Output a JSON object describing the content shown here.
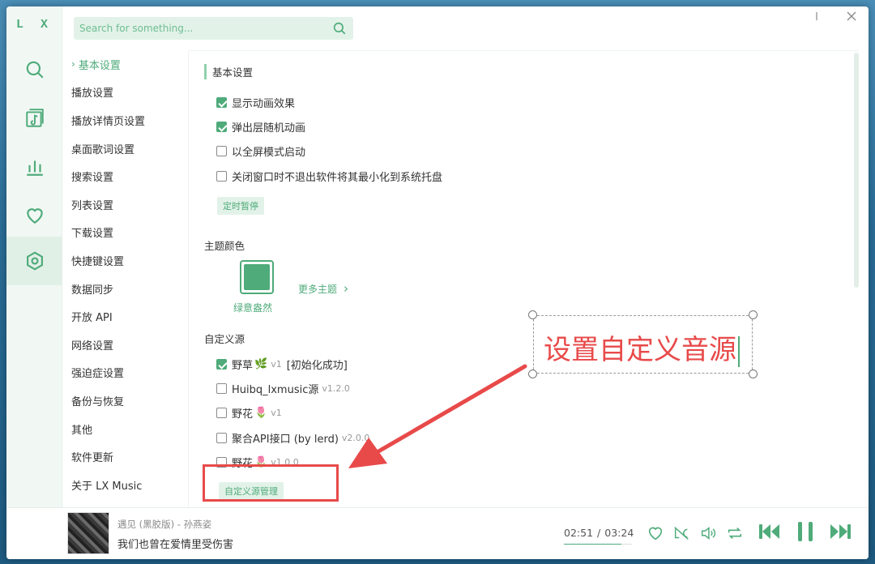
{
  "app": {
    "logo": "L X",
    "search_placeholder": "Search for something..."
  },
  "rail": [
    {
      "name": "search-icon"
    },
    {
      "name": "music-list-icon"
    },
    {
      "name": "chart-icon"
    },
    {
      "name": "heart-icon"
    },
    {
      "name": "settings-icon",
      "active": true
    }
  ],
  "subnav": [
    {
      "label": "基本设置",
      "active": true
    },
    {
      "label": "播放设置"
    },
    {
      "label": "播放详情页设置"
    },
    {
      "label": "桌面歌词设置"
    },
    {
      "label": "搜索设置"
    },
    {
      "label": "列表设置"
    },
    {
      "label": "下载设置"
    },
    {
      "label": "快捷键设置"
    },
    {
      "label": "数据同步"
    },
    {
      "label": "开放 API"
    },
    {
      "label": "网络设置"
    },
    {
      "label": "强迫症设置"
    },
    {
      "label": "备份与恢复"
    },
    {
      "label": "其他"
    },
    {
      "label": "软件更新"
    },
    {
      "label": "关于 LX Music"
    }
  ],
  "basic": {
    "title": "基本设置",
    "options": [
      {
        "label": "显示动画效果",
        "checked": true
      },
      {
        "label": "弹出层随机动画",
        "checked": true
      },
      {
        "label": "以全屏模式启动",
        "checked": false
      },
      {
        "label": "关闭窗口时不退出软件将其最小化到系统托盘",
        "checked": false
      }
    ],
    "timer_button": "定时暂停"
  },
  "theme": {
    "title": "主题颜色",
    "current": "绿意盎然",
    "current_color": "#4fab7a",
    "more": "更多主题"
  },
  "custom_source": {
    "title": "自定义源",
    "sources": [
      {
        "name": "野草",
        "emoji": "🌿",
        "version": "v1",
        "status": "[初始化成功]",
        "checked": true
      },
      {
        "name": "Huibq_lxmusic源",
        "emoji": "",
        "version": "v1.2.0",
        "status": "",
        "checked": false
      },
      {
        "name": "野花",
        "emoji": "🌷",
        "version": "v1",
        "status": "",
        "checked": false
      },
      {
        "name": "聚合API接口 (by lerd)",
        "emoji": "",
        "version": "v2.0.0",
        "status": "",
        "checked": false
      },
      {
        "name": "野花",
        "emoji": "🌷",
        "version": "v1.0.0",
        "status": "",
        "checked": false
      }
    ],
    "manage_button": "自定义源管理"
  },
  "annotation": {
    "text": "设置自定义音源",
    "color": "#e84a4a"
  },
  "player": {
    "title": "遇见 (黑胶版) - 孙燕姿",
    "lyric": "我们也曾在爱情里受伤害",
    "current_time": "02:51",
    "total_time": "03:24",
    "progress": 0.84
  },
  "colors": {
    "accent": "#4fab7a",
    "accent_light": "#e2f2e8"
  }
}
